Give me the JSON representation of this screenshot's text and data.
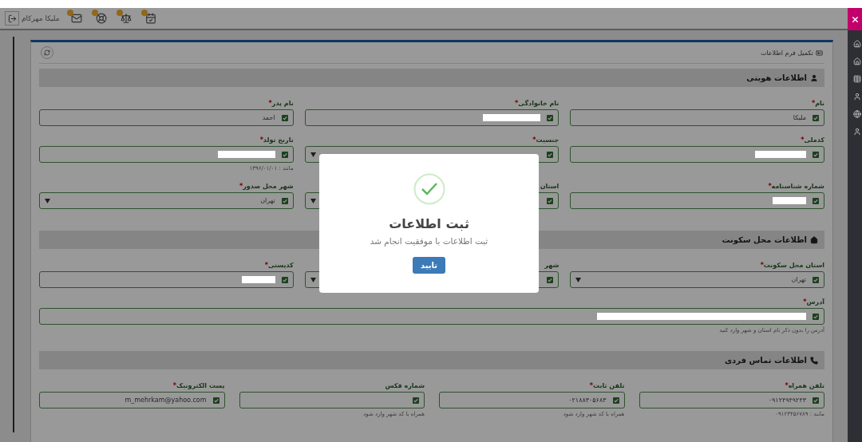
{
  "top_bar": {
    "user_name": "ملیکا مهرکام",
    "notifications": [
      {
        "kind": "mail",
        "badge": true
      },
      {
        "kind": "support",
        "badge": true
      },
      {
        "kind": "scale",
        "badge": true
      },
      {
        "kind": "calendar",
        "badge": true
      }
    ]
  },
  "sidebar": {
    "items": [
      {
        "kind": "home"
      },
      {
        "kind": "home"
      },
      {
        "kind": "table"
      },
      {
        "kind": "user"
      },
      {
        "kind": "globe"
      },
      {
        "kind": "user"
      }
    ]
  },
  "form": {
    "title": "تکمیل فرم اطلاعات",
    "sections": [
      {
        "kind": "identity",
        "title": "اطلاعات هویتی",
        "fields": [
          {
            "kind": "text",
            "label": "نام",
            "mark": "*",
            "valid": true,
            "value": "ملیکا"
          },
          {
            "kind": "text",
            "label": "نام خانوادگی",
            "mark": "*",
            "valid": true,
            "redacted": true
          },
          {
            "kind": "text",
            "label": "نام پدر",
            "mark": "*",
            "valid": true,
            "value": "احمد"
          },
          {
            "kind": "text",
            "label": "کدملی",
            "mark": "*",
            "valid": true,
            "redacted": true
          },
          {
            "kind": "select",
            "label": "جنسیت",
            "mark": "*",
            "valid": true
          },
          {
            "kind": "text",
            "label": "تاریخ تولد",
            "mark": "*",
            "valid": true,
            "redacted": true,
            "hint": "مانند : ۱۳۹۶/۰۱/۰۱"
          },
          {
            "kind": "text",
            "label": "شماره شناسنامه",
            "mark": "*",
            "valid": true,
            "redacted": true
          },
          {
            "kind": "select",
            "label": "استان",
            "valid": true
          },
          {
            "kind": "select",
            "label": "شهر محل صدور",
            "mark": "*",
            "valid": true,
            "value": "تهران"
          }
        ]
      },
      {
        "kind": "residence",
        "title": "اطلاعات محل سکونت",
        "fields": [
          {
            "kind": "select",
            "label": "استان محل سکونت",
            "mark": "*",
            "valid": true,
            "value": "تهران"
          },
          {
            "kind": "select",
            "label": "شهر",
            "valid": true
          },
          {
            "kind": "text",
            "label": "کدپستی",
            "mark": "*",
            "valid": true,
            "redacted": true
          },
          {
            "kind": "wide",
            "label": "آدرس",
            "mark": "*",
            "valid": true,
            "redacted": true,
            "hint": "آدرس را بدون ذکر نام استان و شهر وارد کنید"
          }
        ]
      },
      {
        "kind": "contact",
        "title": "اطلاعات تماس فردی",
        "fields": [
          {
            "kind": "text",
            "label": "تلفن همراه",
            "mark": "*",
            "valid": true,
            "value": "۰۹۱۲۴۹۴۹۲۴۳",
            "hint": "مانند : ۰۹۱۲۳۴۵۶۷۸۹"
          },
          {
            "kind": "text",
            "label": "تلفن ثابت",
            "mark": "*",
            "valid": true,
            "value": "۰۲۱۸۸۳۰۵۶۸۳",
            "hint": "همراه با کد شهر وارد شود"
          },
          {
            "kind": "text",
            "label": "شماره فکس",
            "valid": true,
            "hint": "همراه با کد شهر وارد شود"
          },
          {
            "kind": "text",
            "label": "پست الکترونیک",
            "mark": "*",
            "valid": true,
            "value": "m_mehrkam@yahoo.com"
          }
        ]
      }
    ]
  },
  "dialog": {
    "open": true,
    "title": "ثبت اطلاعات",
    "message": "ثبت اطلاعات با موفقیت انجام شد",
    "button": "تایید"
  }
}
